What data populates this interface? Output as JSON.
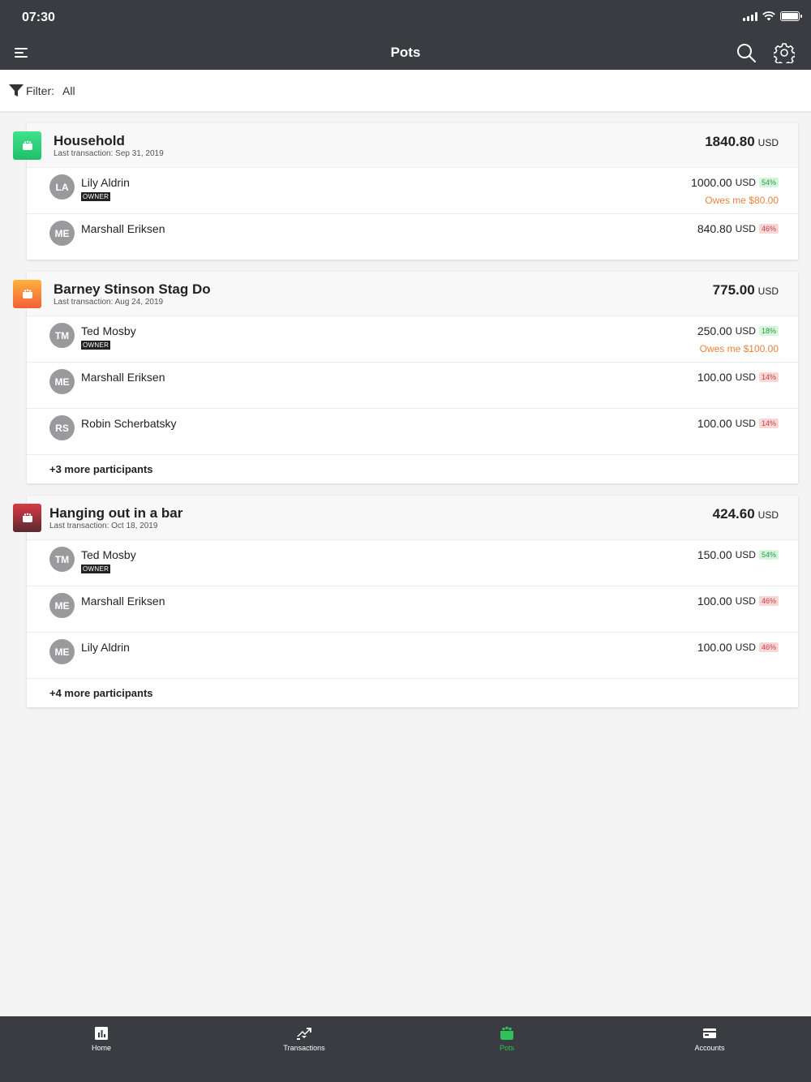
{
  "status_bar": {
    "time": "07:30"
  },
  "nav": {
    "title": "Pots"
  },
  "filter": {
    "label": "Filter:",
    "value": "All"
  },
  "pots": [
    {
      "name": "Household",
      "last_transaction": "Last transaction: Sep 31, 2019",
      "total": "1840.80",
      "currency": "USD",
      "color": "#2ecc71",
      "members": [
        {
          "initials": "LA",
          "name": "Lily Aldrin",
          "owner": true,
          "owner_label": "OWNER",
          "amount": "1000.00",
          "currency": "USD",
          "percent": "54%",
          "trend": "green",
          "owes": "Owes me $80.00"
        },
        {
          "initials": "ME",
          "name": "Marshall Eriksen",
          "amount": "840.80",
          "currency": "USD",
          "percent": "46%",
          "trend": "red"
        }
      ]
    },
    {
      "name": "Barney Stinson Stag Do",
      "last_transaction": "Last transaction: Aug 24, 2019",
      "total": "775.00",
      "currency": "USD",
      "color": "#f7893a",
      "members": [
        {
          "initials": "TM",
          "name": "Ted Mosby",
          "owner": true,
          "owner_label": "OWNER",
          "amount": "250.00",
          "currency": "USD",
          "percent": "18%",
          "trend": "green",
          "owes": "Owes me $100.00"
        },
        {
          "initials": "ME",
          "name": "Marshall Eriksen",
          "amount": "100.00",
          "currency": "USD",
          "percent": "14%",
          "trend": "red"
        },
        {
          "initials": "RS",
          "name": "Robin Scherbatsky",
          "amount": "100.00",
          "currency": "USD",
          "percent": "14%",
          "trend": "red"
        }
      ],
      "more": "+3 more participants"
    },
    {
      "name": "Hanging out in a bar",
      "last_transaction": "Last transaction: Oct 18, 2019",
      "total": "424.60",
      "currency": "USD",
      "color": "#b0323f",
      "members": [
        {
          "initials": "TM",
          "name": "Ted Mosby",
          "owner": true,
          "owner_label": "OWNER",
          "amount": "150.00",
          "currency": "USD",
          "percent": "54%",
          "trend": "green"
        },
        {
          "initials": "ME",
          "name": "Marshall Eriksen",
          "amount": "100.00",
          "currency": "USD",
          "percent": "46%",
          "trend": "red"
        },
        {
          "initials": "ME",
          "name": "Lily Aldrin",
          "amount": "100.00",
          "currency": "USD",
          "percent": "46%",
          "trend": "red"
        }
      ],
      "more": "+4 more participants"
    }
  ],
  "tabs": [
    {
      "label": "Home",
      "icon": "chart-icon"
    },
    {
      "label": "Transactions",
      "icon": "transfer-icon"
    },
    {
      "label": "Pots",
      "icon": "pot-icon",
      "active": true
    },
    {
      "label": "Accounts",
      "icon": "card-icon"
    }
  ],
  "colors": {
    "accent": "#2ec25b",
    "dark": "#3a3c41",
    "owes": "#e8843d"
  }
}
